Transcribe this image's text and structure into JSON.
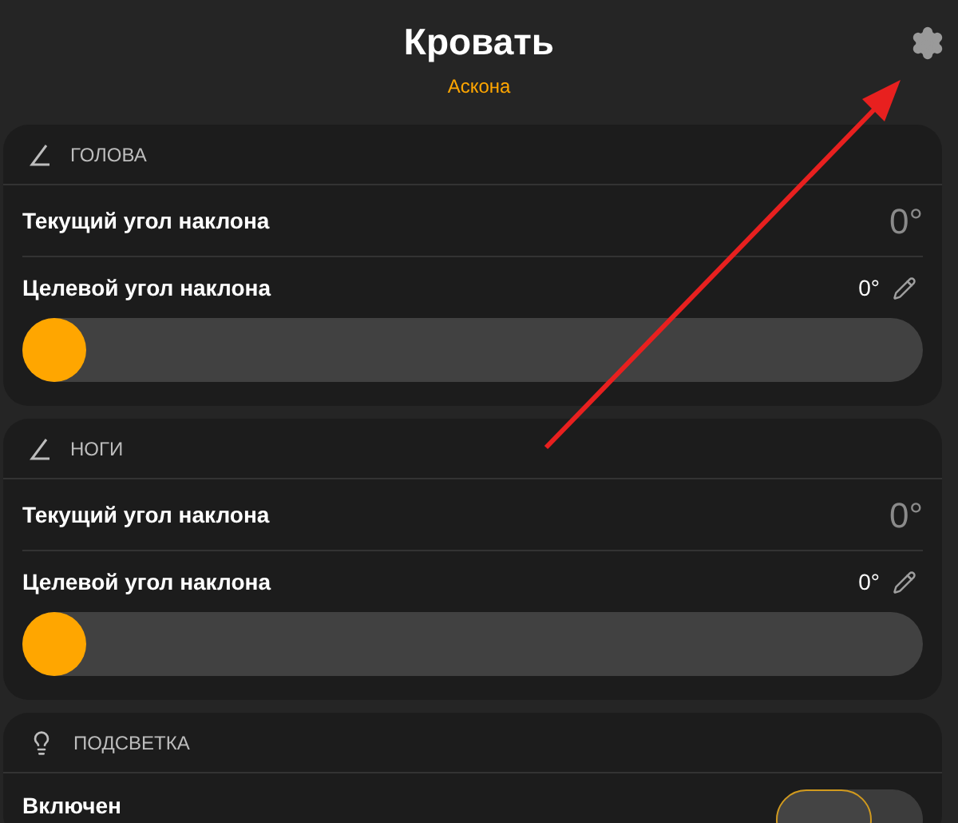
{
  "header": {
    "title": "Кровать",
    "subtitle": "Аскона"
  },
  "sections": [
    {
      "kind": "tilt",
      "title": "ГОЛОВА",
      "current_label": "Текущий угол наклона",
      "current_value": "0°",
      "target_label": "Целевой угол наклона",
      "target_value": "0°",
      "level": 0
    },
    {
      "kind": "tilt",
      "title": "НОГИ",
      "current_label": "Текущий угол наклона",
      "current_value": "0°",
      "target_label": "Целевой угол наклона",
      "target_value": "0°",
      "level": 0
    },
    {
      "kind": "light",
      "title": "ПОДСВЕТКА",
      "switch_label": "Включен",
      "on": false
    }
  ]
}
